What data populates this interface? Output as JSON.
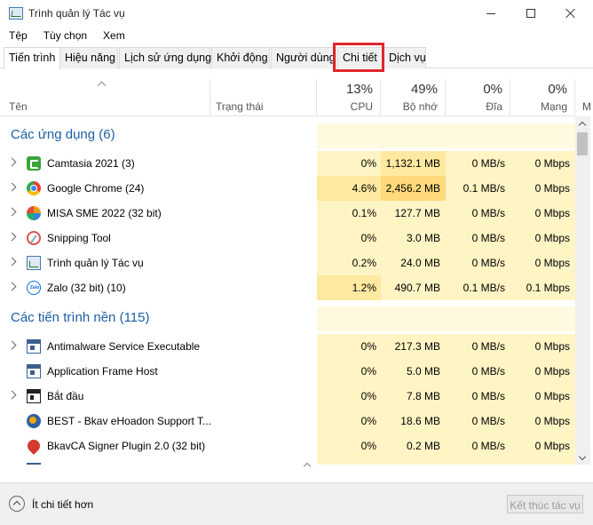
{
  "window": {
    "title": "Trình quản lý Tác vụ"
  },
  "menu": [
    "Tệp",
    "Tùy chọn",
    "Xem"
  ],
  "tabs": [
    "Tiến trình",
    "Hiệu năng",
    "Lịch sử ứng dụng",
    "Khởi động",
    "Người dùng",
    "Chi tiết",
    "Dịch vụ"
  ],
  "active_tab": "Tiến trình",
  "highlighted_tab": "Chi tiết",
  "highlight_color": "#e0252b",
  "columns": {
    "name": "Tên",
    "status": "Trạng thái",
    "cpu": {
      "pct": "13%",
      "label": "CPU"
    },
    "memory": {
      "pct": "49%",
      "label": "Bộ nhớ"
    },
    "disk": {
      "pct": "0%",
      "label": "Đĩa"
    },
    "network": {
      "pct": "0%",
      "label": "Mạng"
    },
    "extra": "M"
  },
  "groups": {
    "apps": "Các ứng dụng (6)",
    "background": "Các tiến trình nền (115)"
  },
  "apps": [
    {
      "icon": "camtasia-icon",
      "name": "Camtasia 2021 (3)",
      "cpu": "0%",
      "mem": "1,132.1 MB",
      "disk": "0 MB/s",
      "net": "0 Mbps"
    },
    {
      "icon": "chrome-icon",
      "name": "Google Chrome (24)",
      "cpu": "4.6%",
      "mem": "2,456.2 MB",
      "disk": "0.1 MB/s",
      "net": "0 Mbps"
    },
    {
      "icon": "misa-icon",
      "name": "MISA SME 2022 (32 bit)",
      "cpu": "0.1%",
      "mem": "127.7 MB",
      "disk": "0 MB/s",
      "net": "0 Mbps"
    },
    {
      "icon": "snipping-tool-icon",
      "name": "Snipping Tool",
      "cpu": "0%",
      "mem": "3.0 MB",
      "disk": "0 MB/s",
      "net": "0 Mbps"
    },
    {
      "icon": "task-manager-icon",
      "name": "Trình quản lý Tác vụ",
      "cpu": "0.2%",
      "mem": "24.0 MB",
      "disk": "0 MB/s",
      "net": "0 Mbps"
    },
    {
      "icon": "zalo-icon",
      "name": "Zalo (32 bit) (10)",
      "cpu": "1.2%",
      "mem": "490.7 MB",
      "disk": "0.1 MB/s",
      "net": "0.1 Mbps"
    }
  ],
  "background": [
    {
      "icon": "antimalware-icon",
      "name": "Antimalware Service Executable",
      "cpu": "0%",
      "mem": "217.3 MB",
      "disk": "0 MB/s",
      "net": "0 Mbps"
    },
    {
      "icon": "app-frame-host-icon",
      "name": "Application Frame Host",
      "cpu": "0%",
      "mem": "5.0 MB",
      "disk": "0 MB/s",
      "net": "0 Mbps"
    },
    {
      "icon": "start-icon",
      "name": "Bắt đầu",
      "cpu": "0%",
      "mem": "7.8 MB",
      "disk": "0 MB/s",
      "net": "0 Mbps"
    },
    {
      "icon": "bkav-ehoadon-icon",
      "name": "BEST - Bkav eHoadon Support T...",
      "cpu": "0%",
      "mem": "18.6 MB",
      "disk": "0 MB/s",
      "net": "0 Mbps"
    },
    {
      "icon": "bkavca-icon",
      "name": "BkavCA Signer Plugin 2.0 (32 bit)",
      "cpu": "0%",
      "mem": "0.2 MB",
      "disk": "0 MB/s",
      "net": "0 Mbps"
    }
  ],
  "footer": {
    "fewer_details": "Ít chi tiết hơn",
    "end_task": "Kết thúc tác vụ"
  },
  "colors": {
    "group_title": "#1f5fa6",
    "cell_light": "#fff4c4",
    "cell_medium": "#ffe9a0"
  }
}
